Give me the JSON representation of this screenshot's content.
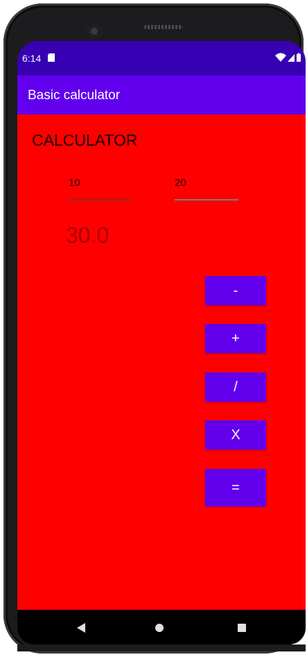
{
  "status_bar": {
    "time": "6:14",
    "icons": [
      "sim-card-icon",
      "wifi-icon",
      "signal-icon",
      "battery-icon"
    ]
  },
  "app_bar": {
    "title": "Basic calculator"
  },
  "main": {
    "heading": "CALCULATOR",
    "input1_value": "10",
    "input2_value": "20",
    "result": "30.0",
    "buttons": {
      "subtract": "-",
      "add": "+",
      "divide": "/",
      "multiply": "X",
      "equals": "="
    }
  },
  "nav_bar": {
    "icons": [
      "back-icon",
      "home-icon",
      "recents-icon"
    ]
  },
  "colors": {
    "background": "#ff0000",
    "status_bar": "#3700b3",
    "app_bar": "#6200ee",
    "button": "#6200ee",
    "nav_bar": "#000000"
  }
}
